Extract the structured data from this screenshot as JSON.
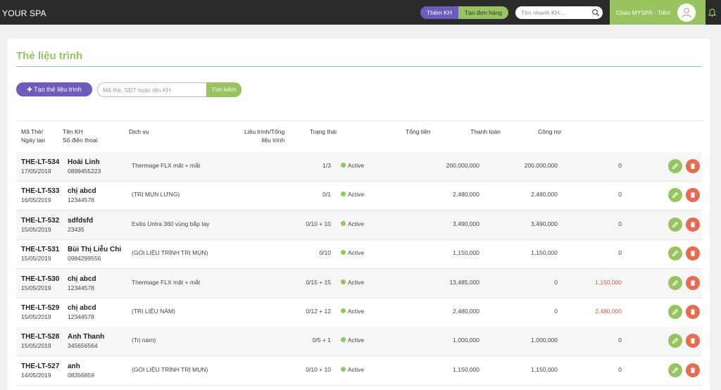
{
  "header": {
    "brand": "YOUR SPA",
    "add_customer_label": "Thêm KH",
    "create_order_label": "Tạo đơn hàng",
    "quick_search_placeholder": "Tìm nhanh KH...",
    "greeting": "Chào MYSPA - Tiến!",
    "icons": [
      "search-icon",
      "avatar-user-icon",
      "bell-icon"
    ]
  },
  "page": {
    "title": "Thẻ liệu trình",
    "create_button_label": "Tạo thẻ liệu trình",
    "search_placeholder": "Mã thẻ, SĐT hoặc tên KH",
    "search_button_label": "Tìm kiếm"
  },
  "table": {
    "headers": {
      "code_line1": "Mã Thẻ/",
      "code_line2": "Ngày tạo",
      "name_line1": "Tên KH",
      "name_line2": "Số điện thoại",
      "service": "Dịch vụ",
      "progress_line1": "Liệu trình/Tổng",
      "progress_line2": "liệu trình",
      "status": "Trạng thái",
      "total": "Tổng tiền",
      "paid": "Thanh toán",
      "debt": "Công nợ"
    },
    "rows": [
      {
        "code": "THE-LT-534",
        "date": "17/05/2019",
        "name": "Hoài Linh",
        "phone": "0899455223",
        "service": "Thermage FLX mặt + mắt",
        "progress": "1/3",
        "status": "Active",
        "total": "200,000,000",
        "paid": "200,000,000",
        "debt": "0",
        "debt_highlight": false
      },
      {
        "code": "THE-LT-533",
        "date": "16/05/2019",
        "name": "chị abcd",
        "phone": "12344578",
        "service": "(TRỊ MỤN LƯNG)",
        "progress": "0/1",
        "status": "Active",
        "total": "2,480,000",
        "paid": "2,480,000",
        "debt": "0",
        "debt_highlight": false
      },
      {
        "code": "THE-LT-532",
        "date": "15/05/2019",
        "name": "sdfdsfd",
        "phone": "23435",
        "service": "Exilis Untra 360 vùng bắp tay",
        "progress": "0/10 + 10",
        "status": "Active",
        "total": "3,490,000",
        "paid": "3,490,000",
        "debt": "0",
        "debt_highlight": false
      },
      {
        "code": "THE-LT-531",
        "date": "15/05/2019",
        "name": "Bùi Thị Liễu Chi",
        "phone": "0984299556",
        "service": "(GÓI LIỆU TRÌNH TRỊ MỤN)",
        "progress": "0/10",
        "status": "Active",
        "total": "1,150,000",
        "paid": "1,150,000",
        "debt": "0",
        "debt_highlight": false
      },
      {
        "code": "THE-LT-530",
        "date": "15/05/2019",
        "name": "chị abcd",
        "phone": "12344578",
        "service": "Thermage FLX mặt + mắt",
        "progress": "0/15 + 15",
        "status": "Active",
        "total": "13,485,000",
        "paid": "0",
        "debt": "1,150,000",
        "debt_highlight": true
      },
      {
        "code": "THE-LT-529",
        "date": "15/05/2019",
        "name": "chị abcd",
        "phone": "12344578",
        "service": "(TRỊ LIỆU NÁM)",
        "progress": "0/12 + 12",
        "status": "Active",
        "total": "2,480,000",
        "paid": "0",
        "debt": "2,480,000",
        "debt_highlight": true
      },
      {
        "code": "THE-LT-528",
        "date": "15/05/2019",
        "name": "Anh Thanh",
        "phone": "345656564",
        "service": "(Trị nám)",
        "progress": "0/5 + 1",
        "status": "Active",
        "total": "1,000,000",
        "paid": "1,000,000",
        "debt": "0",
        "debt_highlight": false
      },
      {
        "code": "THE-LT-527",
        "date": "14/05/2019",
        "name": "anh",
        "phone": "08356859",
        "service": "(GÓI LIỆU TRÌNH TRỊ MỤN)",
        "progress": "0/10 + 10",
        "status": "Active",
        "total": "1,150,000",
        "paid": "1,150,000",
        "debt": "0",
        "debt_highlight": false
      }
    ]
  },
  "colors": {
    "accent_purple": "#6e5bbf",
    "accent_green": "#97c45f",
    "danger_red": "#e86a4f",
    "debt_text_red": "#e0584a",
    "topbar": "#2b2b2b"
  }
}
